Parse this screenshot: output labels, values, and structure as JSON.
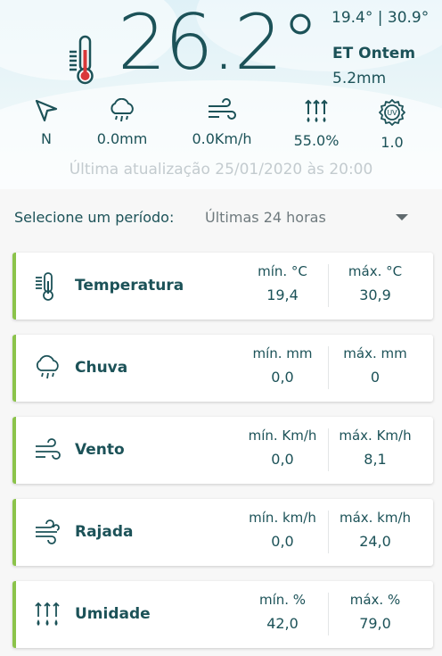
{
  "current": {
    "temperature": "26.2°",
    "minmax": "19.4° | 30.9°",
    "et_label": "ET Ontem",
    "et_value": "5.2mm"
  },
  "stats": {
    "direction": "N",
    "rain": "0.0mm",
    "wind": "0.0Km/h",
    "humidity": "55.0%",
    "uv": "1.0"
  },
  "updated": "Última atualização 25/01/2020 às 20:00",
  "period": {
    "label": "Selecione um período:",
    "selected": "Últimas 24 horas"
  },
  "cards": [
    {
      "title": "Temperatura",
      "min_label": "mín. °C",
      "min_value": "19,4",
      "max_label": "máx. °C",
      "max_value": "30,9"
    },
    {
      "title": "Chuva",
      "min_label": "mín. mm",
      "min_value": "0,0",
      "max_label": "máx. mm",
      "max_value": "0"
    },
    {
      "title": "Vento",
      "min_label": "mín. Km/h",
      "min_value": "0,0",
      "max_label": "máx. Km/h",
      "max_value": "8,1"
    },
    {
      "title": "Rajada",
      "min_label": "mín. km/h",
      "min_value": "0,0",
      "max_label": "máx. km/h",
      "max_value": "24,0"
    },
    {
      "title": "Umidade",
      "min_label": "mín. %",
      "min_value": "42,0",
      "max_label": "máx. %",
      "max_value": "79,0"
    }
  ],
  "icons": {
    "thermometer": "thermometer-icon",
    "direction": "navigation-arrow-icon",
    "rain": "rain-cloud-icon",
    "wind": "wind-icon",
    "humidity": "humidity-icon",
    "uv": "uv-index-icon",
    "gust": "gust-icon",
    "dropdown": "chevron-down-icon"
  },
  "colors": {
    "text": "#1c5258",
    "accent": "#8bc34a",
    "thermo_red": "#d9383a",
    "muted": "#c3cbcf"
  }
}
